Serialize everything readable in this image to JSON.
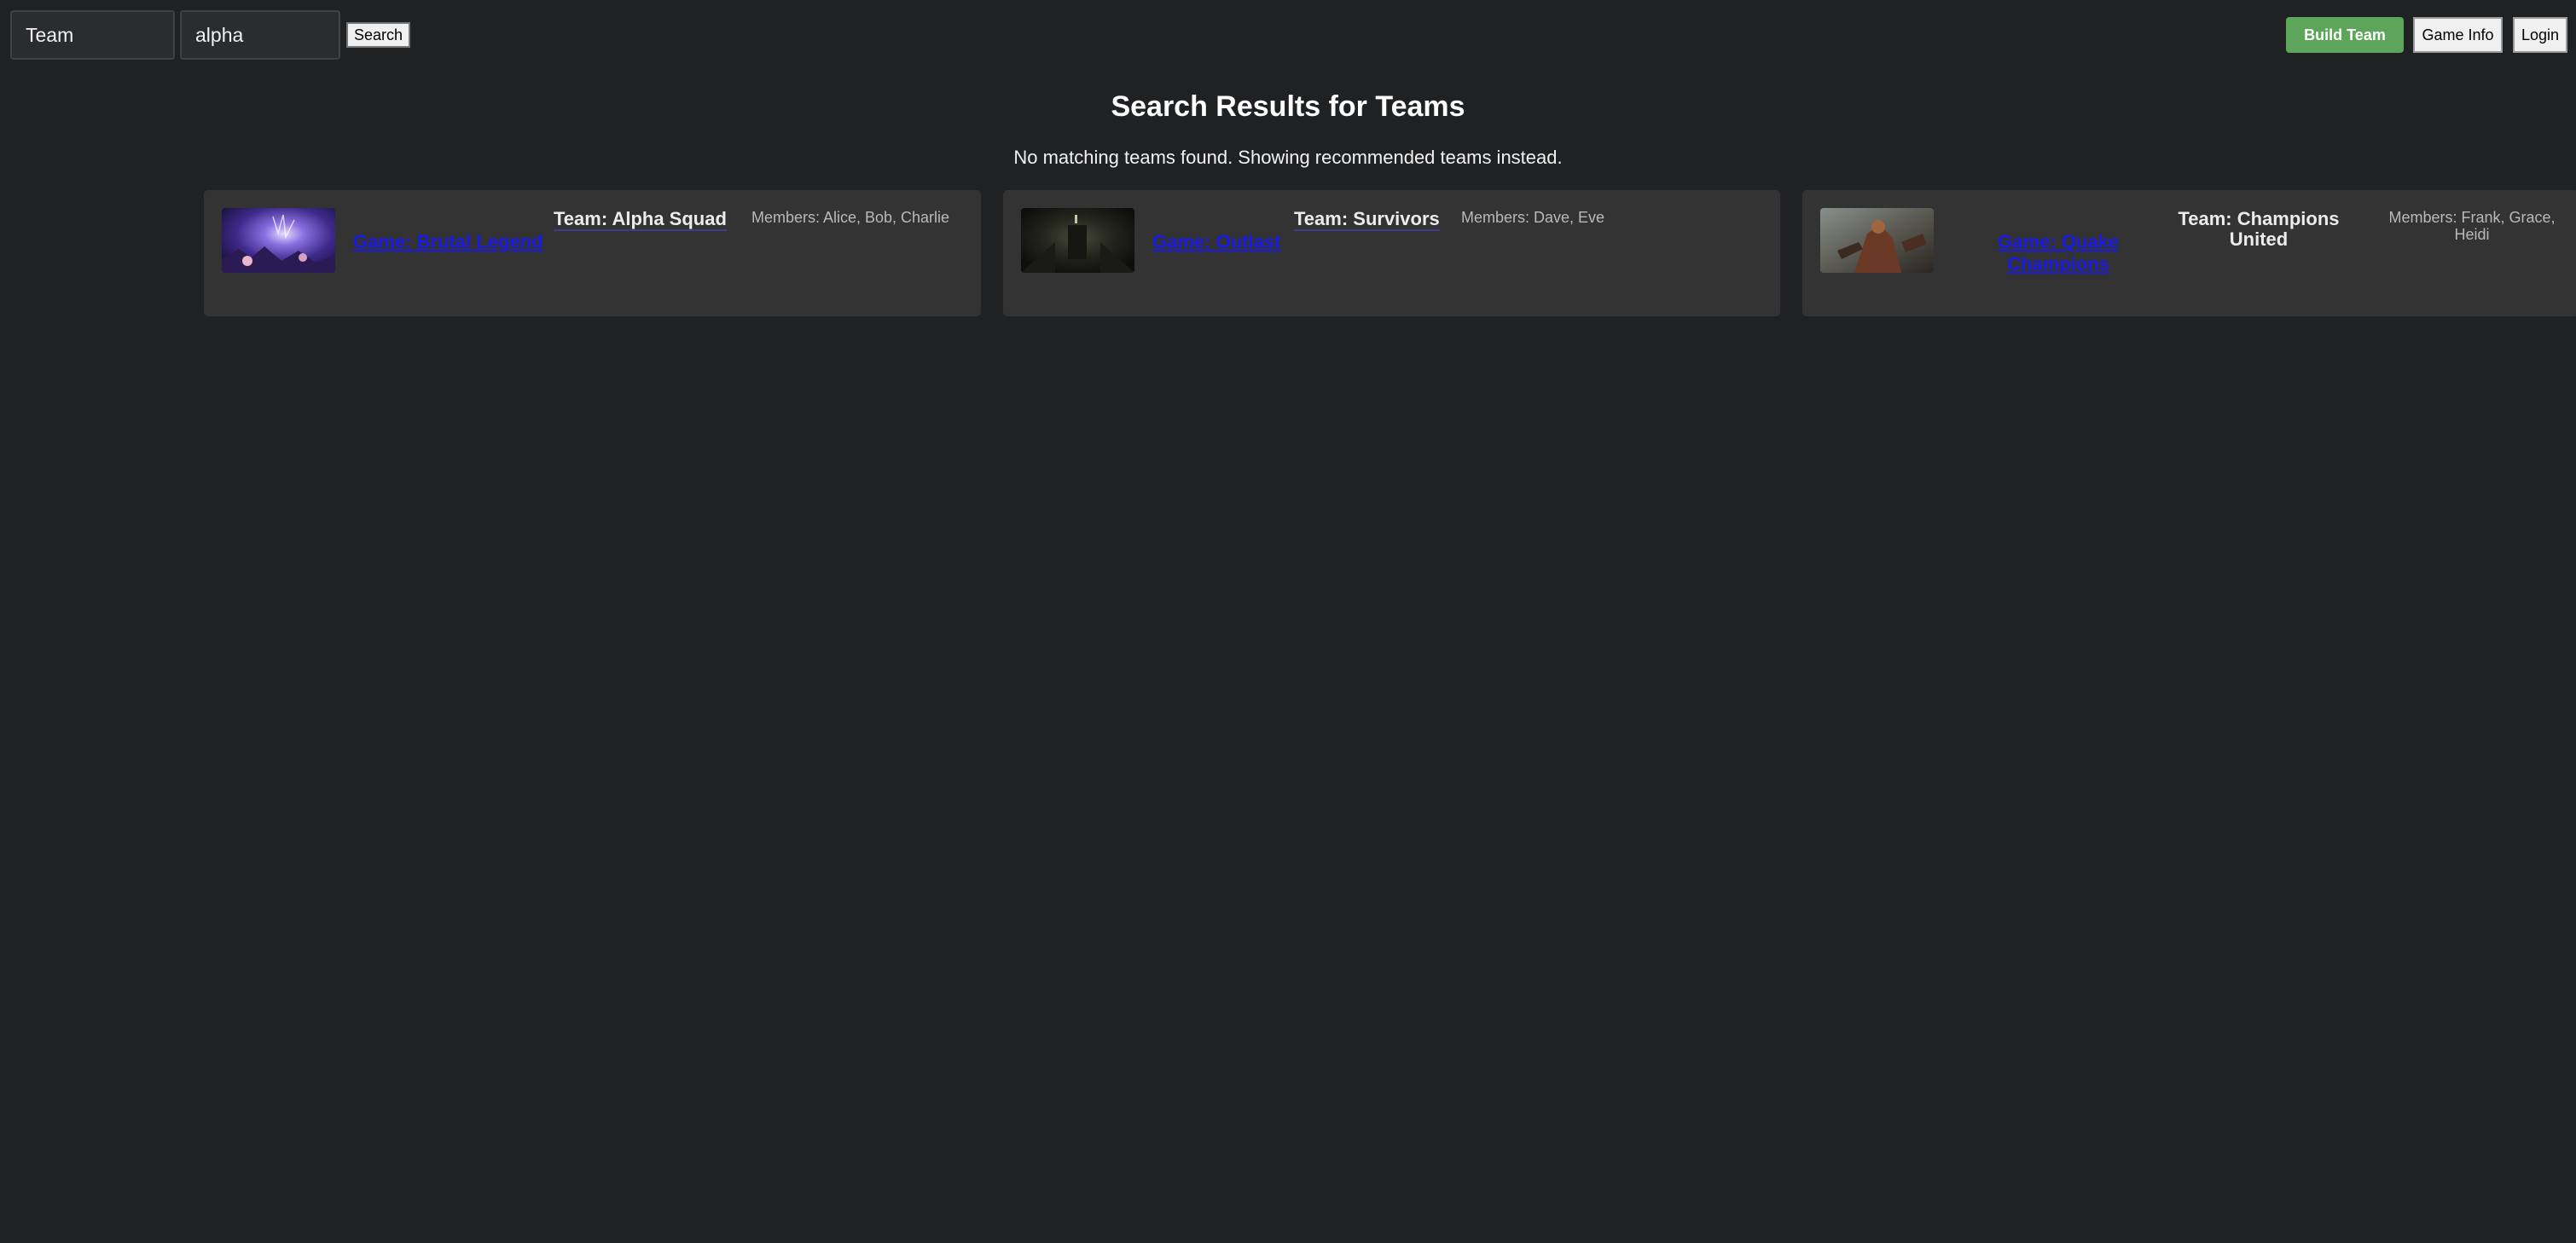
{
  "search": {
    "category_value": "Team",
    "query_value": "alpha",
    "button_label": "Search"
  },
  "nav": {
    "build_team_label": "Build Team",
    "game_info_label": "Game Info",
    "login_label": "Login"
  },
  "results": {
    "title": "Search Results for Teams",
    "notice": "No matching teams found. Showing recommended teams instead."
  },
  "teams": [
    {
      "game": "Game: Brutal Legend",
      "team": "Team: Alpha Squad",
      "members": "Members: Alice, Bob, Charlie",
      "thumbnail": "brutal-legend-artwork"
    },
    {
      "game": "Game: Outlast",
      "team": "Team: Survivors",
      "members": "Members: Dave, Eve",
      "thumbnail": "outlast-artwork"
    },
    {
      "game": "Game: Quake Champions",
      "team": "Team: Champions United",
      "members": "Members: Frank, Grace, Heidi",
      "thumbnail": "quake-champions-artwork"
    }
  ],
  "colors": {
    "background": "#202123",
    "card": "#333333",
    "accent_green": "#5ea55c",
    "link_blue": "#1a1ae8"
  }
}
